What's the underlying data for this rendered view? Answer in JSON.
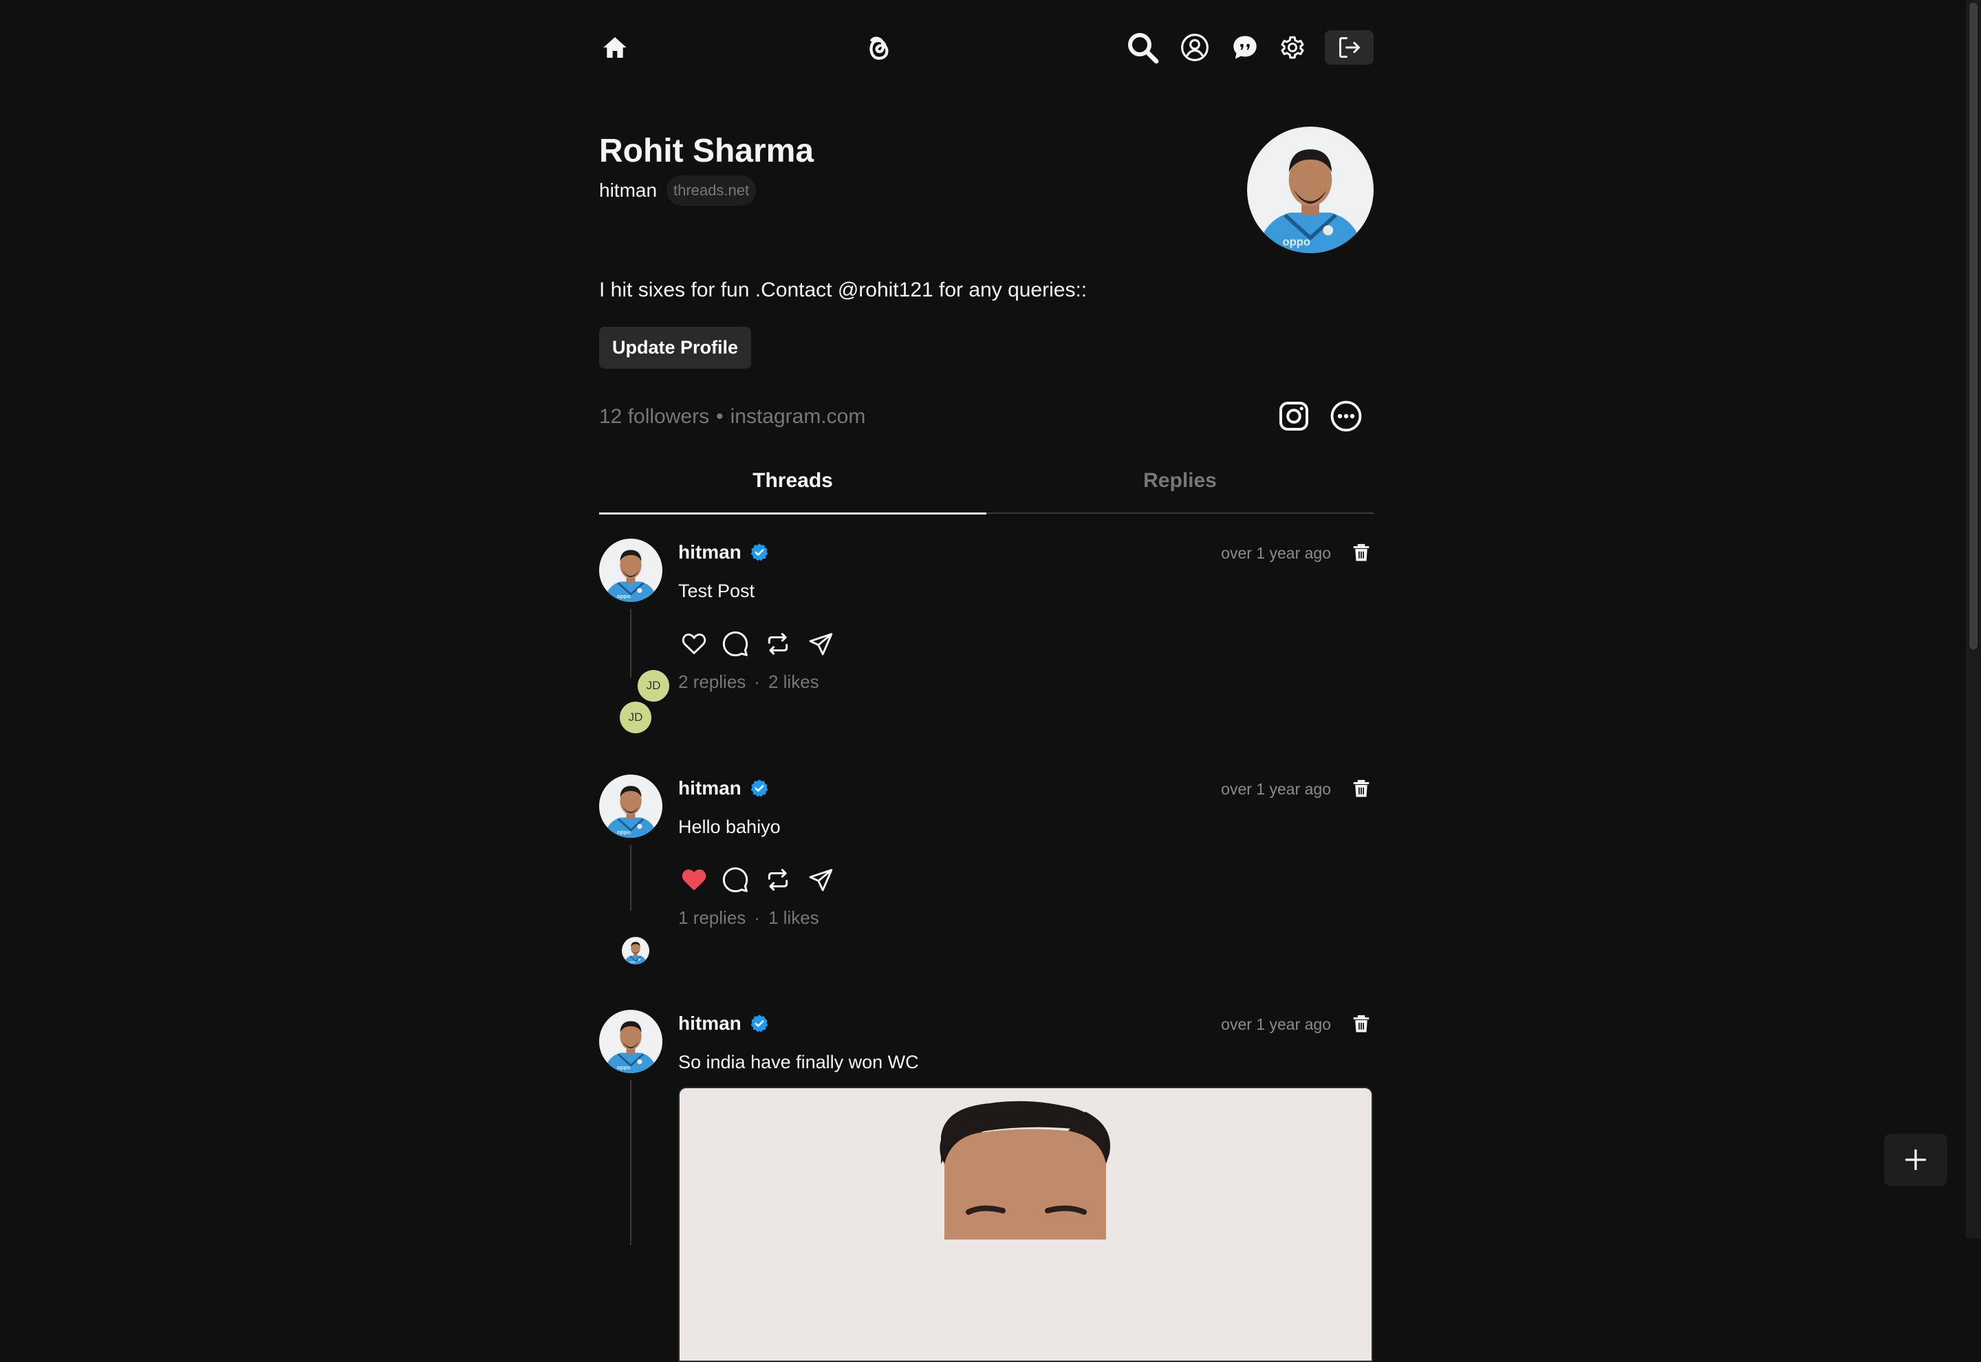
{
  "header": {
    "icons": [
      "home-icon",
      "threads-logo-icon",
      "search-icon",
      "user-icon",
      "chat-icon",
      "gear-icon",
      "logout-icon"
    ]
  },
  "profile": {
    "name": "Rohit Sharma",
    "username": "hitman",
    "domain": "threads.net",
    "bio": "I hit sixes for fun .Contact @rohit121 for any queries::",
    "update_button": "Update Profile",
    "followers": "12 followers",
    "stats_separator": "•",
    "link": "instagram.com"
  },
  "tabs": [
    {
      "label": "Threads",
      "active": true
    },
    {
      "label": "Replies",
      "active": false
    }
  ],
  "posts": [
    {
      "username": "hitman",
      "verified": true,
      "time": "over 1 year ago",
      "text": "Test Post",
      "liked": false,
      "replies": "2 replies",
      "dot": "·",
      "likes": "2 likes",
      "reply_avatars": [
        "JD",
        "JD"
      ]
    },
    {
      "username": "hitman",
      "verified": true,
      "time": "over 1 year ago",
      "text": "Hello bahiyo",
      "liked": true,
      "replies": "1 replies",
      "dot": "·",
      "likes": "1 likes"
    },
    {
      "username": "hitman",
      "verified": true,
      "time": "over 1 year ago",
      "text": "So india have finally won WC"
    }
  ],
  "colors": {
    "background": "#101010",
    "text": "#f3f5f7",
    "muted": "#777777",
    "verified": "#1d9bf0",
    "like_active": "#ed4956",
    "reply_avatar": "#c9d88a"
  }
}
